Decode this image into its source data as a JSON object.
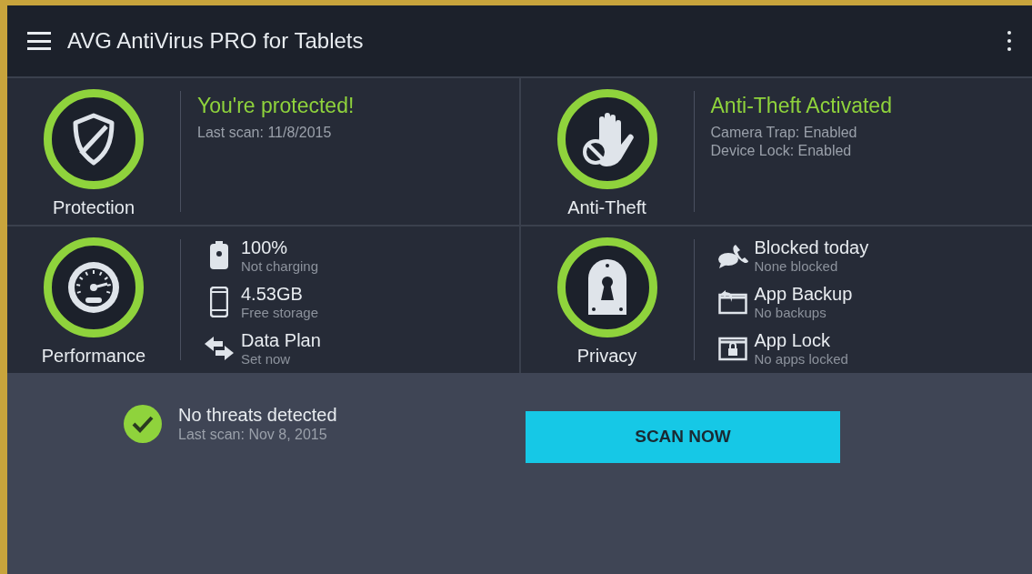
{
  "app_bar": {
    "title": "AVG AntiVirus PRO for Tablets"
  },
  "tiles": [
    {
      "kind": "status",
      "label": "Protection",
      "headline": "You're protected!",
      "lines": [
        "Last scan: 11/8/2015"
      ]
    },
    {
      "kind": "status",
      "label": "Anti-Theft",
      "headline": "Anti-Theft Activated",
      "lines": [
        "Camera Trap: Enabled",
        "Device Lock: Enabled"
      ]
    },
    {
      "kind": "list",
      "label": "Performance",
      "items": [
        {
          "title": "100%",
          "subtitle": "Not charging"
        },
        {
          "title": "4.53GB",
          "subtitle": "Free storage"
        },
        {
          "title": "Data Plan",
          "subtitle": "Set now"
        }
      ]
    },
    {
      "kind": "list",
      "label": "Privacy",
      "items": [
        {
          "title": "Blocked today",
          "subtitle": "None blocked"
        },
        {
          "title": "App Backup",
          "subtitle": "No backups"
        },
        {
          "title": "App Lock",
          "subtitle": "No apps locked"
        }
      ]
    }
  ],
  "scan_status": {
    "title": "No threats detected",
    "subtitle": "Last scan: Nov 8, 2015"
  },
  "scan_button": {
    "label": "SCAN NOW"
  }
}
